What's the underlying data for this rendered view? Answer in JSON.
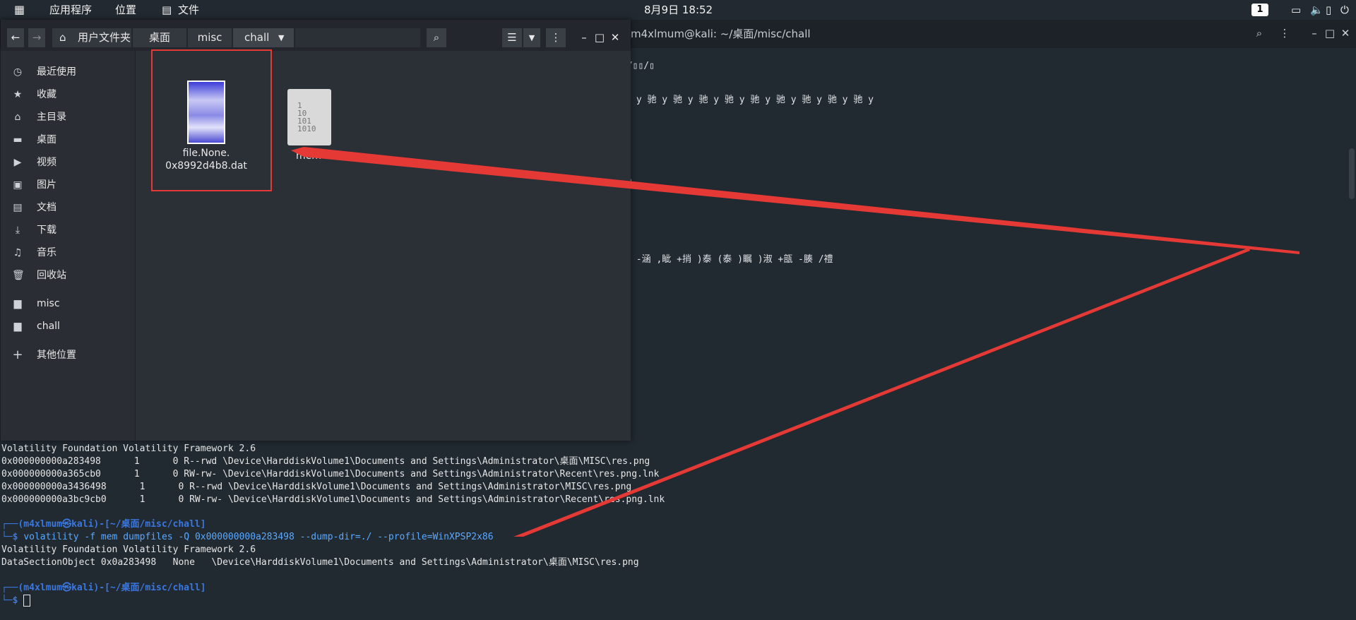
{
  "topbar": {
    "apps_label": "应用程序",
    "places_label": "位置",
    "files_label": "文件",
    "datetime": "8月9日  18:52",
    "workspace": "1"
  },
  "terminal": {
    "title": "m4xlmum@kali: ~/桌面/misc/chall",
    "lines": [
      "Volatility Foundation Volatility Framework 2.6",
      "0x000000000a283498      1      0 R--rwd \\Device\\HarddiskVolume1\\Documents and Settings\\Administrator\\桌面\\MISC\\res.png",
      "0x000000000a365cb0      1      0 RW-rw- \\Device\\HarddiskVolume1\\Documents and Settings\\Administrator\\Recent\\res.png.lnk",
      "0x000000000a3436498      1      0 R--rwd \\Device\\HarddiskVolume1\\Documents and Settings\\Administrator\\MISC\\res.png",
      "0x000000000a3bc9cb0      1      0 RW-rw- \\Device\\HarddiskVolume1\\Documents and Settings\\Administrator\\Recent\\res.png.lnk"
    ],
    "prompt_user": "(m4xlmum㉿kali)-[~/桌面/misc/chall]",
    "command": "volatility -f mem dumpfiles -Q 0x000000000a283498 --dump-dir=./ --profile=WinXPSP2x86",
    "output1": "Volatility Foundation Volatility Framework 2.6",
    "output2": "DataSectionObject 0x0a283498   None   \\Device\\HarddiskVolume1\\Documents and Settings\\Administrator\\桌面\\MISC\\res.png",
    "prompt_user2": "(m4xlmum㉿kali)-[~/桌面/misc/chall]",
    "garbled": [
      "▯/▯▯/▯",
      "驰 y 驰 y 驰 y 驰 y 驰 y 驰 y 驰 y 驰 y 驰 y 驰 y",
      "▯▯",
      "殺 -涵 ,眦 +捎 )泰 (泰 )瞩 )淑 +瓿 -腠 /禮"
    ]
  },
  "filemanager": {
    "breadcrumb": [
      "用户文件夹",
      "桌面",
      "misc",
      "chall"
    ],
    "sidebar": [
      {
        "icon": "clock-icon",
        "glyph": "◷",
        "label": "最近使用"
      },
      {
        "icon": "star-icon",
        "glyph": "★",
        "label": "收藏"
      },
      {
        "icon": "home-icon",
        "glyph": "⌂",
        "label": "主目录"
      },
      {
        "icon": "desktop-icon",
        "glyph": "▬",
        "label": "桌面"
      },
      {
        "icon": "video-icon",
        "glyph": "▶",
        "label": "视频"
      },
      {
        "icon": "image-icon",
        "glyph": "▣",
        "label": "图片"
      },
      {
        "icon": "document-icon",
        "glyph": "▤",
        "label": "文档"
      },
      {
        "icon": "download-icon",
        "glyph": "⤓",
        "label": "下载"
      },
      {
        "icon": "music-icon",
        "glyph": "♫",
        "label": "音乐"
      },
      {
        "icon": "trash-icon",
        "glyph": "🗑",
        "label": "回收站"
      },
      {
        "icon": "folder-icon",
        "glyph": "▆",
        "label": "misc"
      },
      {
        "icon": "folder-icon",
        "glyph": "▆",
        "label": "chall"
      },
      {
        "icon": "plus-icon",
        "glyph": "+",
        "label": "其他位置"
      }
    ],
    "files": [
      {
        "name_line1": "file.None.",
        "name_line2": "0x8992d4b8.dat"
      },
      {
        "name_line1": "mem",
        "name_line2": ""
      }
    ],
    "binary_icon_text": [
      "1",
      "10",
      "101",
      "1010"
    ]
  },
  "colors": {
    "highlight": "#e53935",
    "prompt": "#3a78e0"
  }
}
